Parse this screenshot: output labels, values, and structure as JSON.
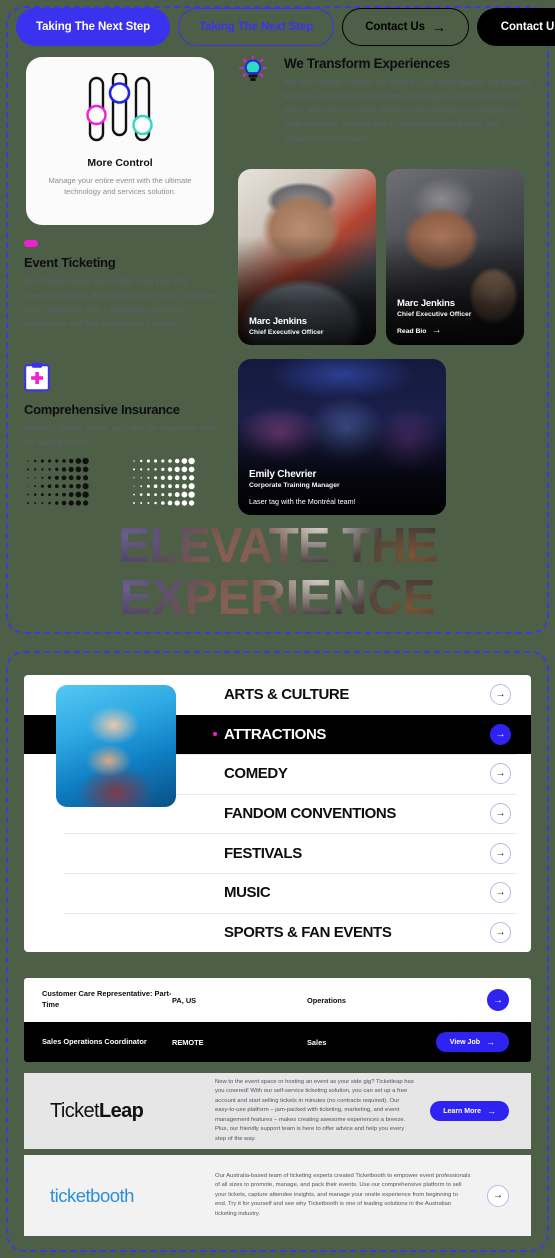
{
  "buttons": [
    {
      "label": "Taking The Next Step",
      "style": "solid-blue",
      "arrow": false
    },
    {
      "label": "Taking The Next Step",
      "style": "ghost-blue",
      "arrow": false
    },
    {
      "label": "Contact Us",
      "style": "ghost-black",
      "arrow": true
    },
    {
      "label": "Contact Us",
      "style": "solid-black",
      "arrow": true
    }
  ],
  "control_card": {
    "title": "More Control",
    "description": "Manage your entire event with the ultimate technology and services solution.",
    "slider_colors": [
      "#f11fd7",
      "#2522e8",
      "#2fd9c2"
    ]
  },
  "features": [
    {
      "title": "Event Ticketing",
      "description": "Sell tickets online and onsite to all your GA, reserved seating, and timed entry events. Surprise your customers with a seamless purchase experience and fast admissions process.",
      "icon": "pink-dash-icon"
    },
    {
      "title": "Comprehensive Insurance",
      "description": "Medical, dental, vision, pet, and life insurance with no waiting period.",
      "icon": "clipboard-medical-icon"
    }
  ],
  "transform": {
    "icon": "lightbulb-icon",
    "title": "We Transform Experiences",
    "description": "We don't follow a script; we write it. Our team pushes the industry forward and revolutionizes how event-goers connect with each other. We are innovative thinkers who unleash our creativity to build solutions creators use to transform their events into impactful experiences."
  },
  "team": [
    {
      "name": "Marc Jenkins",
      "role": "Chief Executive Officer",
      "link": "",
      "note": ""
    },
    {
      "name": "Marc Jenkins",
      "role": "Chief Executive Officer",
      "link": "Read Bio",
      "note": ""
    },
    {
      "name": "Emily Chevrier",
      "role": "Corporate Training Manager",
      "link": "",
      "note": "Laser tag with the Montréal team!"
    }
  ],
  "hero": {
    "line1": "ELEVATE THE",
    "line2": "EXPERIENCE"
  },
  "categories": [
    {
      "label": "ARTS & CULTURE",
      "active": false
    },
    {
      "label": "ATTRACTIONS",
      "active": true
    },
    {
      "label": "COMEDY",
      "active": false
    },
    {
      "label": "FANDOM CONVENTIONS",
      "active": false
    },
    {
      "label": "FESTIVALS",
      "active": false
    },
    {
      "label": "MUSIC",
      "active": false
    },
    {
      "label": "SPORTS & FAN EVENTS",
      "active": false
    }
  ],
  "jobs": {
    "rows": [
      {
        "title": "Customer Care Representative: Part-Time",
        "location": "PA, US",
        "department": "Operations",
        "cta": "",
        "dark": false
      },
      {
        "title": "Sales Operations Coordinator",
        "location": "REMOTE",
        "department": "Sales",
        "cta": "View Job",
        "dark": true
      }
    ]
  },
  "brands": [
    {
      "logo_a": "Ticket",
      "logo_b": "Leap",
      "description": "New to the event space or hosting an event as your side gig? Ticketleap has you covered! With our self-service ticketing solution, you can set up a free account and start selling tickets in minutes (no contracts required). Our easy-to-use platform – jam-packed with ticketing, marketing, and event management features – makes creating awesome experiences a breeze. Plus, our friendly support team is here to offer advice and help you every step of the way.",
      "cta": "Learn More"
    },
    {
      "logo_a": "ticketbooth",
      "logo_b": "",
      "description": "Our Australia-based team of ticketing experts created Ticketbooth to empower event professionals of all sizes to promote, manage, and pack their events. Use our comprehensive platform to sell your tickets, capture attendee insights, and manage your onsite experience from beginning to end. Try it for yourself and see why Ticketbooth is one of leading solutions in the Australian ticketing industry.",
      "cta": ""
    }
  ],
  "colors": {
    "page_background": "#4d6047",
    "accent_blue": "#2e23f0",
    "accent_pink": "#f11fd7",
    "accent_teal": "#2fd9c2",
    "dashed_border": "#3b3bdd"
  },
  "glyphs": {
    "arrow_right": "→"
  }
}
